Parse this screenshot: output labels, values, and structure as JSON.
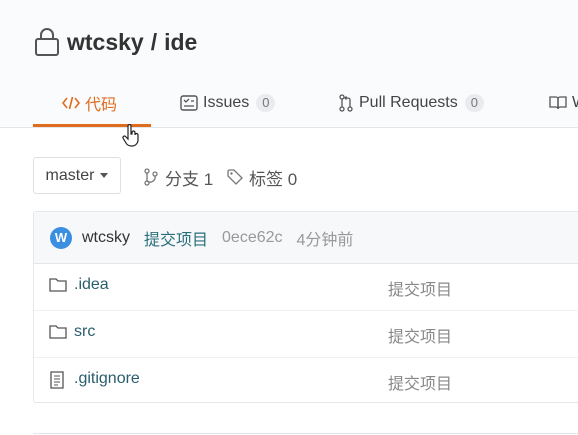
{
  "repo": {
    "owner": "wtcsky",
    "separator": "/",
    "name": "ide"
  },
  "tabs": [
    {
      "label": "代码",
      "icon": "code-icon",
      "active": true
    },
    {
      "label": "Issues",
      "icon": "issues-icon",
      "count": "0"
    },
    {
      "label": "Pull Requests",
      "icon": "pull-request-icon",
      "count": "0"
    },
    {
      "label": "W",
      "icon": "wiki-icon"
    }
  ],
  "branch": {
    "current": "master"
  },
  "meta": {
    "branches_label": "分支 1",
    "tags_label": "标签 0"
  },
  "commit": {
    "avatar_letter": "W",
    "author": "wtcsky",
    "message": "提交项目",
    "hash": "0ece62c",
    "time": "4分钟前"
  },
  "files": [
    {
      "name": ".idea",
      "type": "folder",
      "message": "提交项目"
    },
    {
      "name": "src",
      "type": "folder",
      "message": "提交项目"
    },
    {
      "name": ".gitignore",
      "type": "file",
      "message": "提交项目"
    }
  ],
  "colors": {
    "accent": "#e06c1e",
    "avatar": "#3b8fe0",
    "link": "#2a6f7a"
  }
}
